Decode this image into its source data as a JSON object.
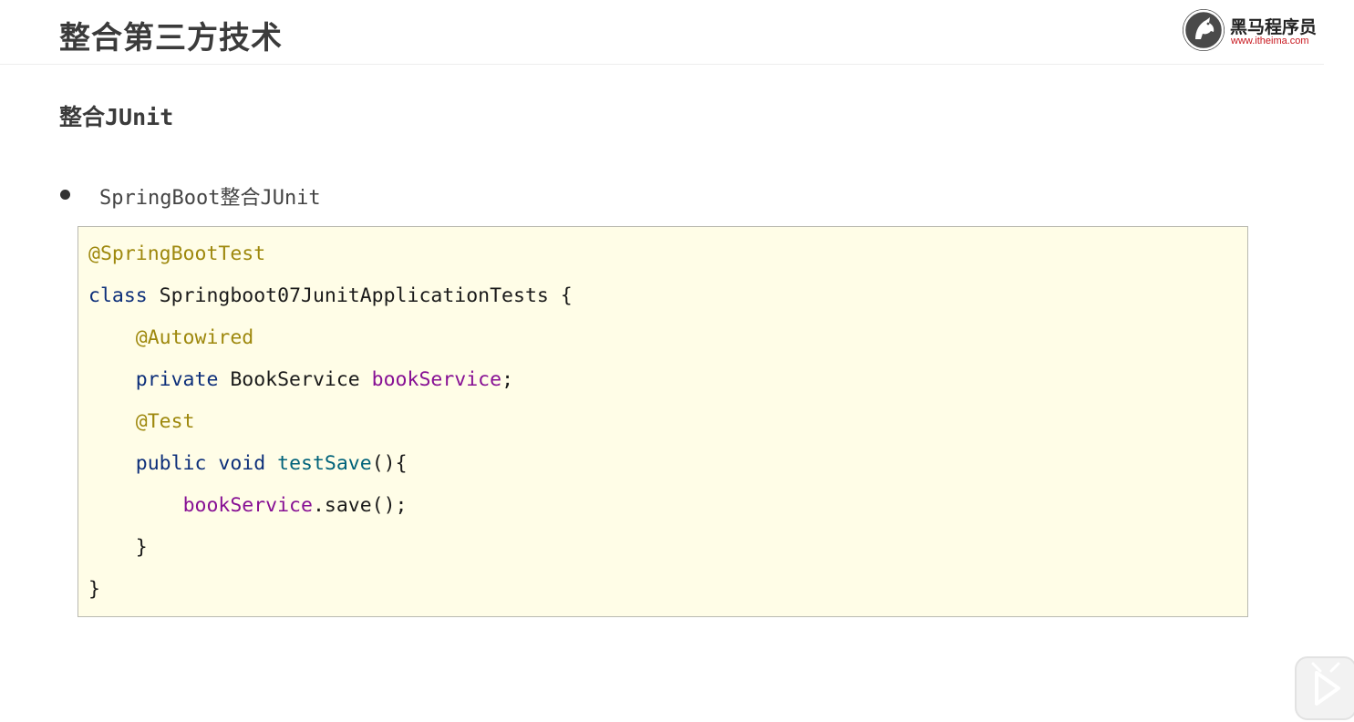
{
  "header": {
    "title": "整合第三方技术",
    "logo": {
      "name_cn": "黑马程序员",
      "url_text": "www.itheima.com"
    }
  },
  "section": {
    "title": "整合JUnit"
  },
  "bullet": {
    "label": "SpringBoot整合JUnit"
  },
  "code": {
    "lines": [
      {
        "indent": "",
        "tokens": [
          {
            "t": "@SpringBootTest",
            "k": "ann"
          }
        ]
      },
      {
        "indent": "",
        "tokens": [
          {
            "t": "class",
            "k": "kw"
          },
          {
            "t": " Springboot07JunitApplicationTests {",
            "k": "plain"
          }
        ]
      },
      {
        "indent": "    ",
        "tokens": [
          {
            "t": "@Autowired",
            "k": "ann"
          }
        ]
      },
      {
        "indent": "    ",
        "tokens": [
          {
            "t": "private",
            "k": "kw"
          },
          {
            "t": " BookService ",
            "k": "plain"
          },
          {
            "t": "bookService",
            "k": "field"
          },
          {
            "t": ";",
            "k": "plain"
          }
        ]
      },
      {
        "indent": "    ",
        "tokens": [
          {
            "t": "@Test",
            "k": "ann"
          }
        ]
      },
      {
        "indent": "    ",
        "tokens": [
          {
            "t": "public",
            "k": "kw"
          },
          {
            "t": " ",
            "k": "plain"
          },
          {
            "t": "void",
            "k": "kw"
          },
          {
            "t": " ",
            "k": "plain"
          },
          {
            "t": "testSave",
            "k": "fn"
          },
          {
            "t": "(){",
            "k": "plain"
          }
        ]
      },
      {
        "indent": "        ",
        "tokens": [
          {
            "t": "bookService",
            "k": "field"
          },
          {
            "t": ".save();",
            "k": "plain"
          }
        ]
      },
      {
        "indent": "    ",
        "tokens": [
          {
            "t": "}",
            "k": "plain"
          }
        ]
      },
      {
        "indent": "",
        "tokens": [
          {
            "t": "}",
            "k": "plain"
          }
        ]
      }
    ]
  },
  "colors": {
    "annotation": "#9e880d",
    "keyword": "#0d2f7a",
    "field": "#871094",
    "method": "#00627a",
    "code_background": "#fffde7",
    "logo_url": "#c8161d"
  },
  "icons": {
    "logo": "horse-logo-icon",
    "player": "play-icon"
  }
}
